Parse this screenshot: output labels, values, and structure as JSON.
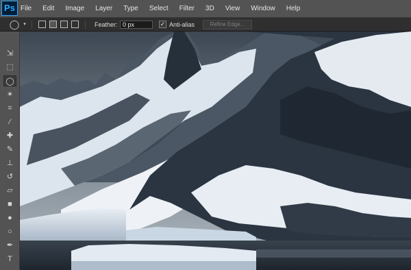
{
  "app": {
    "logo": "Ps"
  },
  "menu": [
    "File",
    "Edit",
    "Image",
    "Layer",
    "Type",
    "Select",
    "Filter",
    "3D",
    "View",
    "Window",
    "Help"
  ],
  "options": {
    "feather_label": "Feather:",
    "feather_value": "0 px",
    "antialias_label": "Anti-alias",
    "antialias_checked": "✓",
    "refine_edge": "Refine Edge..."
  },
  "tools": [
    {
      "name": "move-tool",
      "glyph": "⇲"
    },
    {
      "name": "marquee-tool",
      "glyph": "⬚"
    },
    {
      "name": "lasso-tool",
      "glyph": "◯",
      "active": true
    },
    {
      "name": "magic-wand-tool",
      "glyph": "✶"
    },
    {
      "name": "crop-tool",
      "glyph": "⌗"
    },
    {
      "name": "eyedropper-tool",
      "glyph": "⁄"
    },
    {
      "name": "healing-brush-tool",
      "glyph": "✚"
    },
    {
      "name": "brush-tool",
      "glyph": "✎"
    },
    {
      "name": "clone-stamp-tool",
      "glyph": "⊥"
    },
    {
      "name": "history-brush-tool",
      "glyph": "↺"
    },
    {
      "name": "eraser-tool",
      "glyph": "▱"
    },
    {
      "name": "gradient-tool",
      "glyph": "■"
    },
    {
      "name": "blur-tool",
      "glyph": "●"
    },
    {
      "name": "dodge-tool",
      "glyph": "○"
    },
    {
      "name": "pen-tool",
      "glyph": "✒"
    },
    {
      "name": "type-tool",
      "glyph": "T"
    }
  ],
  "colors": {
    "ui_dark": "#535353",
    "ui_bar": "#2f2f2f",
    "brand": "#31a8ff"
  }
}
